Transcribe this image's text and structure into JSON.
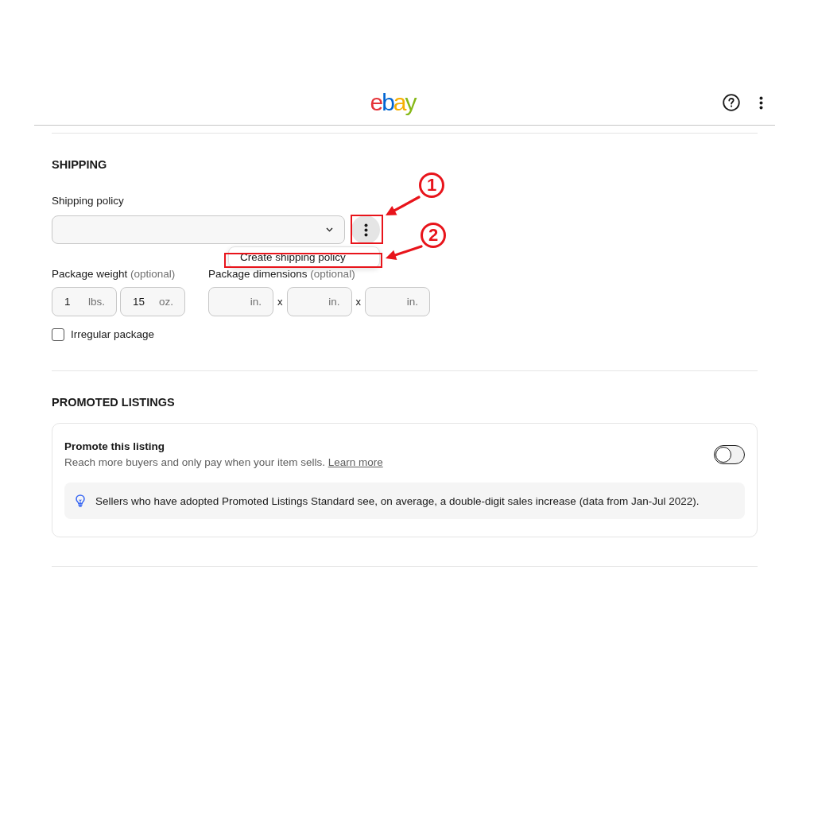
{
  "header": {
    "logo": [
      {
        "char": "e",
        "color": "#e53238"
      },
      {
        "char": "b",
        "color": "#0064d2"
      },
      {
        "char": "a",
        "color": "#f5af02"
      },
      {
        "char": "y",
        "color": "#86b817"
      }
    ]
  },
  "shipping": {
    "heading": "SHIPPING",
    "policy_label": "Shipping policy",
    "more_menu": {
      "open": true,
      "items": [
        {
          "label": "Create shipping policy"
        }
      ]
    },
    "weight": {
      "label": "Package weight",
      "optional": "(optional)",
      "fields": [
        {
          "value": "1",
          "unit": "lbs."
        },
        {
          "value": "15",
          "unit": "oz."
        }
      ]
    },
    "dimensions": {
      "label": "Package dimensions",
      "optional": "(optional)",
      "fields": [
        {
          "unit": "in."
        },
        {
          "unit": "in."
        },
        {
          "unit": "in."
        }
      ],
      "separators": [
        "x",
        "x"
      ]
    },
    "irregular_package": {
      "label": "Irregular package",
      "checked": false
    }
  },
  "promoted_listings": {
    "heading": "PROMOTED LISTINGS",
    "card": {
      "title": "Promote this listing",
      "description": "Reach more buyers and only pay when your item sells.",
      "link": "Learn more",
      "on": false,
      "tip": "Sellers who have adopted Promoted Listings Standard see, on average, a double-digit sales increase (data from Jan-Jul 2022)."
    }
  },
  "annotations": [
    {
      "number": "1"
    },
    {
      "number": "2"
    }
  ]
}
